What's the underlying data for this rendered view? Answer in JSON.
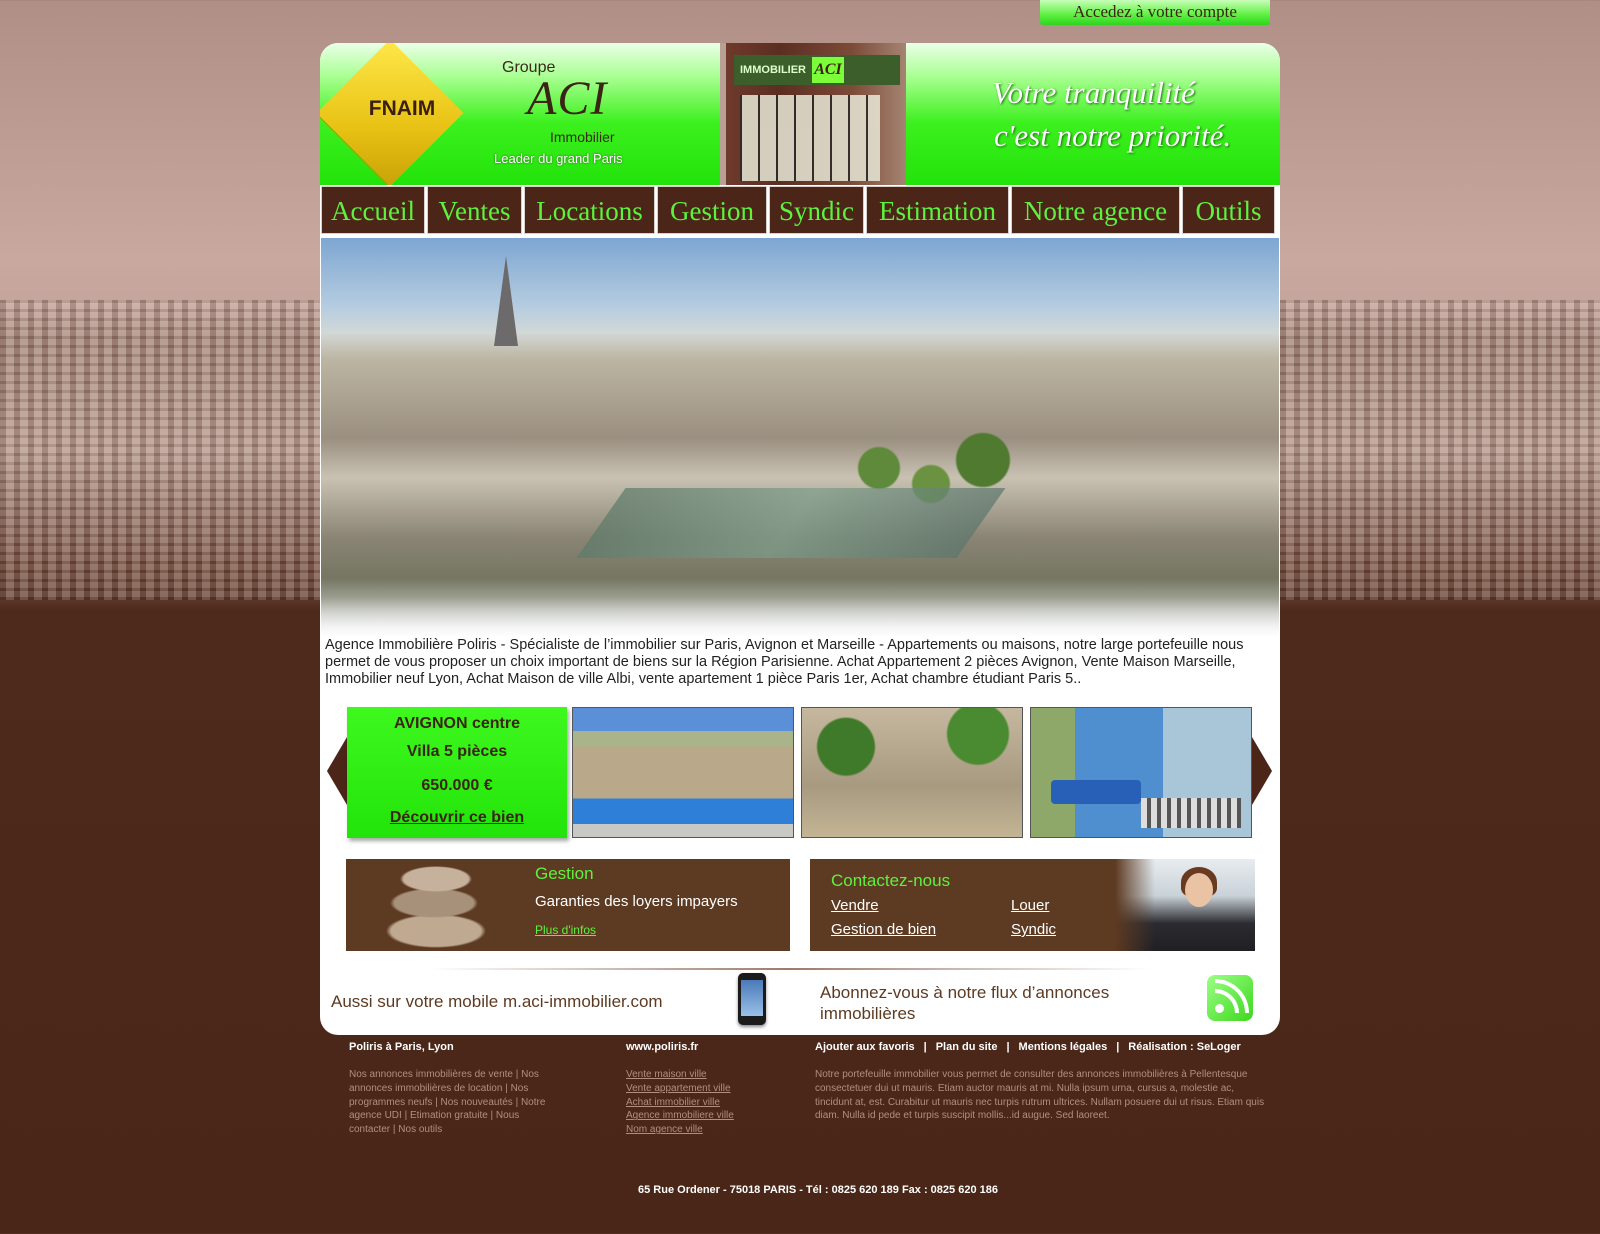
{
  "account_button": "Accedez à votre compte",
  "header": {
    "fnaim": "FNAIM",
    "groupe": "Groupe",
    "brand": "ACI",
    "immobilier": "Immobilier",
    "tagline": "Leader du grand Paris",
    "store_sign": "IMMOBILIER",
    "store_aci": "ACI",
    "slogan_line1": "Votre tranquilité",
    "slogan_line2": "c'est notre priorité."
  },
  "nav": [
    {
      "label": "Accueil"
    },
    {
      "label": "Ventes"
    },
    {
      "label": "Locations"
    },
    {
      "label": "Gestion"
    },
    {
      "label": "Syndic"
    },
    {
      "label": "Estimation"
    },
    {
      "label": "Notre agence"
    },
    {
      "label": "Outils"
    }
  ],
  "intro": "Agence Immobilière Poliris - Spécialiste de l’immobilier sur Paris, Avignon et Marseille - Appartements ou maisons, notre large portefeuille nous permet de vous proposer un choix important de biens sur la Région Parisienne. Achat Appartement 2 pièces Avignon, Vente Maison Marseille, Immobilier neuf Lyon, Achat Maison de ville Albi, vente apartement 1 pièce Paris 1er, Achat chambre étudiant Paris 5..",
  "featured": {
    "city": "AVIGNON centre",
    "type": "Villa 5 pièces",
    "price": "650.000 €",
    "cta": "Découvrir ce bien"
  },
  "gestion_panel": {
    "title": "Gestion",
    "text": "Garanties des loyers impayers",
    "link": "Plus d'infos"
  },
  "contact_panel": {
    "title": "Contactez-nous",
    "links": [
      "Vendre",
      "Louer",
      "Gestion de bien",
      "Syndic"
    ]
  },
  "mobile": {
    "text": "Aussi sur votre  mobile m.aci-immobilier.com"
  },
  "rss": {
    "text": "Abonnez-vous à notre flux d’annonces immobilières"
  },
  "footer": {
    "col1_title": "Poliris à Paris, Lyon",
    "col1_text": "Nos annonces immobilières de vente | Nos annonces immobilières de location | Nos programmes neufs | Nos nouveautés | Notre agence UDI | Etimation gratuite | Nous contacter | Nos outils",
    "col2_title": "www.poliris.fr",
    "col2_links": [
      "Vente maison ville",
      "Vente appartement ville",
      "Achat immobilier ville",
      "Agence immobiliere ville",
      "Nom agence ville"
    ],
    "links": [
      "Ajouter aux favoris",
      "Plan du site",
      "Mentions légales",
      "Réalisation : SeLoger"
    ],
    "col3_text": "Notre portefeuille immobilier vous permet de consulter des annonces immobilières à Pellentesque consectetuer dui ut mauris. Etiam auctor mauris at mi. Nulla ipsum urna, cursus a, molestie ac, tincidunt at, est. Curabitur ut mauris nec turpis rutrum ultrices. Nullam posuere dui ut risus. Etiam quis diam. Nulla id pede et turpis suscipit mollis...id augue. Sed laoreet.",
    "address": "65 Rue Ordener - 75018 PARIS  -  Tél : 0825 620 189  Fax : 0825 620 186"
  },
  "colors": {
    "brand_green": "#5ef13e",
    "brown": "#4b2618",
    "panel_brown": "#5d3a22"
  }
}
